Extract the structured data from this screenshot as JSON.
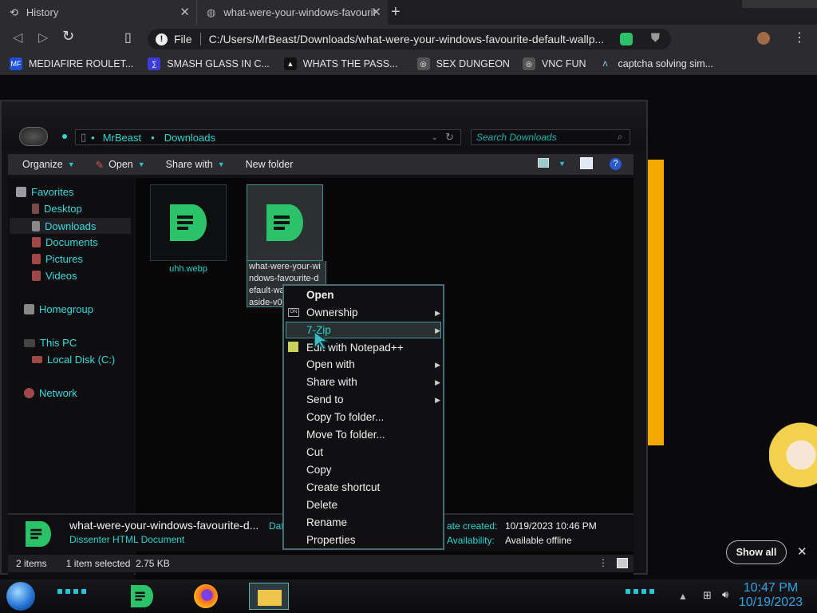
{
  "browser": {
    "tabs": [
      {
        "title": "History"
      },
      {
        "title": "what-were-your-windows-favourit"
      }
    ],
    "new_tab_icon": "plus-icon",
    "address": {
      "scheme_label": "File",
      "url": "C:/Users/MrBeast/Downloads/what-were-your-windows-favourite-default-wallp..."
    },
    "bookmarks": [
      {
        "label": "MEDIAFIRE ROULET...",
        "icon_text": "MF",
        "color": "#1d4fd8"
      },
      {
        "label": "SMASH GLASS IN C...",
        "icon_text": "∑",
        "color": "#3b3bd8"
      },
      {
        "label": "WHATS THE PASS...",
        "icon_text": "▲",
        "color": "#111111"
      },
      {
        "label": "SEX DUNGEON",
        "icon_text": "◎",
        "color": "#555555"
      },
      {
        "label": "VNC FUN",
        "icon_text": "◎",
        "color": "#555555"
      },
      {
        "label": "captcha solving sim...",
        "icon_text": "Λ",
        "color": "#2c2c30"
      }
    ]
  },
  "explorer": {
    "breadcrumb": [
      "MrBeast",
      "Downloads"
    ],
    "search_placeholder": "Search Downloads",
    "commands": [
      "Organize",
      "Open",
      "Share with",
      "New folder"
    ],
    "nav": {
      "favorites": "Favorites",
      "favorites_items": [
        "Desktop",
        "Downloads",
        "Documents",
        "Pictures",
        "Videos"
      ],
      "homegroup": "Homegroup",
      "this_pc": "This PC",
      "local_disk": "Local Disk (C:)",
      "network": "Network"
    },
    "files": [
      {
        "name": "uhh.webp"
      },
      {
        "name_lines": [
          "what-were-your-wi",
          "ndows-favourite-d",
          "efault-wa",
          "aside-v0"
        ]
      }
    ],
    "details": {
      "filename": "what-were-your-windows-favourite-d...",
      "filetype": "Dissenter HTML Document",
      "date_label_partial": "Dat",
      "date_created_label": "ate created:",
      "date_created": "10/19/2023 10:46 PM",
      "availability_label": "Availability:",
      "availability": "Available offline"
    },
    "status": {
      "items": "2 items",
      "selected": "1 item selected  2.75 KB"
    }
  },
  "context_menu": {
    "items": [
      {
        "label": "Open",
        "bold": true
      },
      {
        "label": "Ownership",
        "submenu": true
      },
      {
        "label": "7-Zip",
        "submenu": true
      },
      {
        "label": "Edit with Notepad++"
      },
      {
        "label": "Open with",
        "submenu": true
      },
      {
        "label": "Share with",
        "submenu": true
      },
      {
        "label": "Send to",
        "submenu": true
      },
      {
        "label": "Copy To folder..."
      },
      {
        "label": "Move To folder..."
      },
      {
        "label": "Cut"
      },
      {
        "label": "Copy"
      },
      {
        "label": "Create shortcut"
      },
      {
        "label": "Delete"
      },
      {
        "label": "Rename"
      },
      {
        "label": "Properties"
      }
    ]
  },
  "notification": {
    "show_all": "Show all"
  },
  "taskbar": {
    "time": "10:47 PM",
    "date": "10/19/2023"
  },
  "colors": {
    "accent": "#2fd5d0",
    "app_green": "#2bc36a",
    "clock": "#2ea6e6",
    "orange_bar": "#f5a900"
  }
}
